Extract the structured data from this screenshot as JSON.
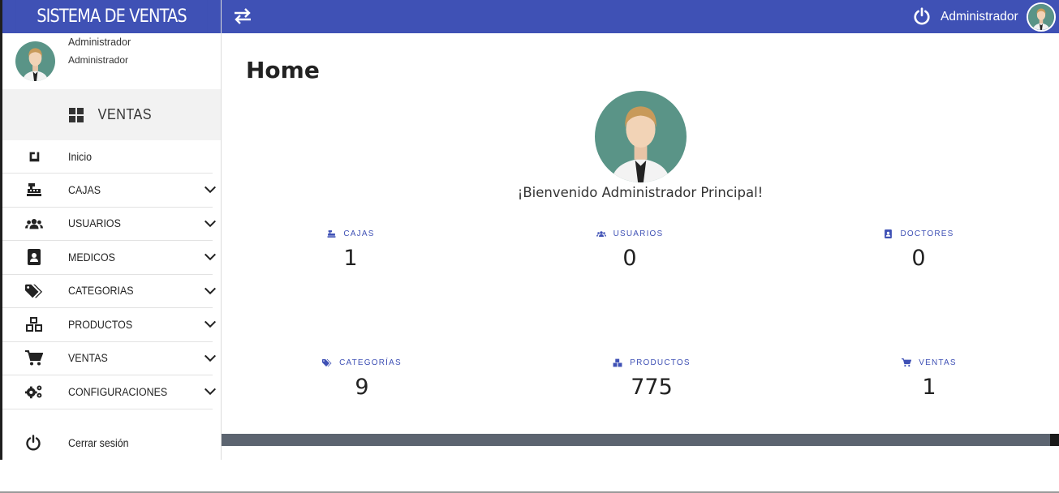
{
  "brand": {
    "title": "SISTEMA DE VENTAS"
  },
  "profile": {
    "name": "Administrador",
    "role": "Administrador"
  },
  "sidebar": {
    "section": "VENTAS",
    "items": [
      {
        "label": "Inicio",
        "icon": "home-icon",
        "expandable": false
      },
      {
        "label": "CAJAS",
        "icon": "cash-register-icon",
        "expandable": true
      },
      {
        "label": "USUARIOS",
        "icon": "users-icon",
        "expandable": true
      },
      {
        "label": "MEDICOS",
        "icon": "id-badge-icon",
        "expandable": true
      },
      {
        "label": "CATEGORIAS",
        "icon": "tags-icon",
        "expandable": true
      },
      {
        "label": "PRODUCTOS",
        "icon": "cubes-icon",
        "expandable": true
      },
      {
        "label": "VENTAS",
        "icon": "cart-icon",
        "expandable": true
      },
      {
        "label": "CONFIGURACIONES",
        "icon": "cogs-icon",
        "expandable": true
      }
    ],
    "logout": "Cerrar sesión"
  },
  "topbar": {
    "user": "Administrador"
  },
  "main": {
    "title": "Home",
    "welcome": "¡Bienvenido Administrador Principal!",
    "stats": [
      {
        "label": "CAJAS",
        "value": "1",
        "icon": "cash-register-icon"
      },
      {
        "label": "USUARIOS",
        "value": "0",
        "icon": "users-icon"
      },
      {
        "label": "DOCTORES",
        "value": "0",
        "icon": "id-badge-icon"
      },
      {
        "label": "CATEGORÍAS",
        "value": "9",
        "icon": "tags-icon"
      },
      {
        "label": "PRODUCTOS",
        "value": "775",
        "icon": "cubes-icon"
      },
      {
        "label": "VENTAS",
        "value": "1",
        "icon": "cart-icon"
      }
    ]
  },
  "colors": {
    "primary": "#3f51b5",
    "avatar_bg": "#5a9487",
    "footer": "#5c6470"
  }
}
